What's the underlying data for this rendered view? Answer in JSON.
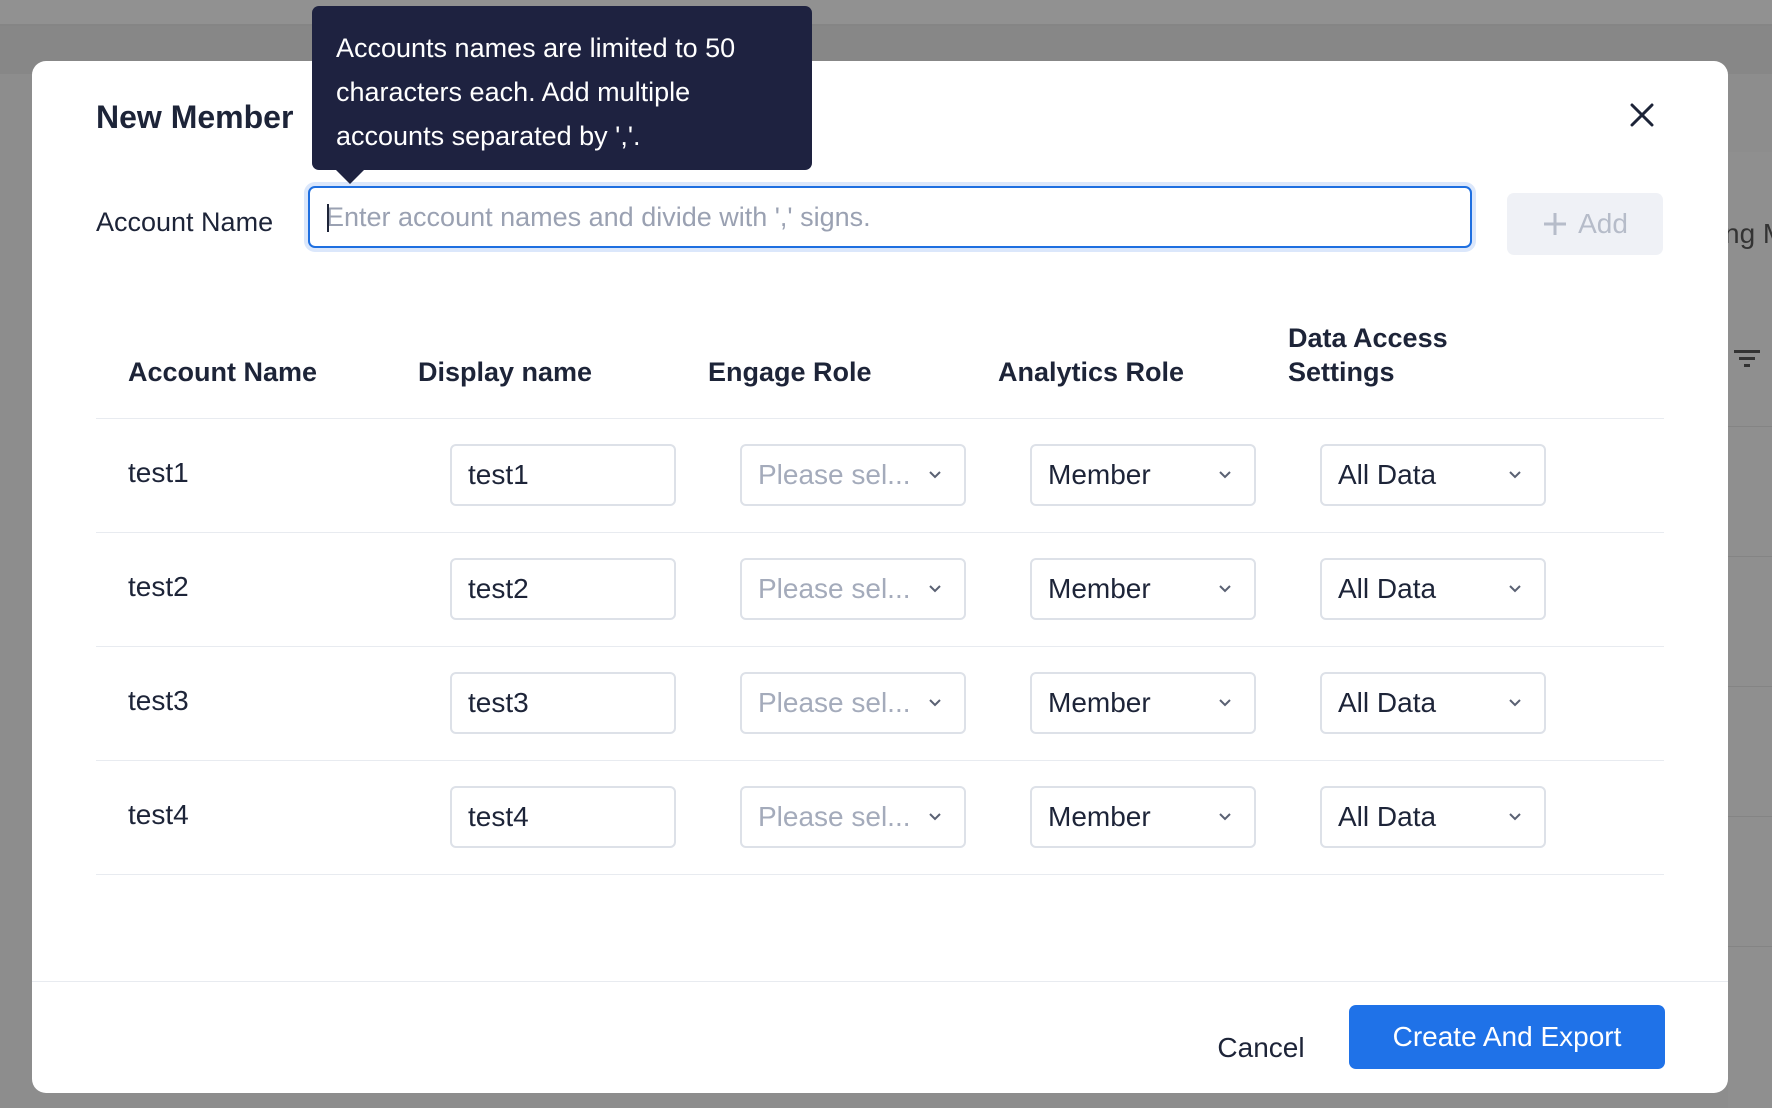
{
  "dialog": {
    "title": "New Member",
    "close_icon": "close-icon"
  },
  "add_row": {
    "label": "Account Name",
    "input_placeholder": "Enter account names and divide with ',' signs.",
    "input_value": "",
    "add_button_label": "Add",
    "add_icon": "plus-icon"
  },
  "tooltip": {
    "text": "Accounts names are limited to 50 characters each. Add multiple accounts separated by ','."
  },
  "table": {
    "headers": [
      "Account Name",
      "Display name",
      "Engage Role",
      "Analytics Role",
      "Data Access Settings"
    ],
    "rows": [
      {
        "account_name": "test1",
        "display_name": "test1",
        "engage_role": "Please sel...",
        "analytics_role": "Member",
        "data_access": "All Data"
      },
      {
        "account_name": "test2",
        "display_name": "test2",
        "engage_role": "Please sel...",
        "analytics_role": "Member",
        "data_access": "All Data"
      },
      {
        "account_name": "test3",
        "display_name": "test3",
        "engage_role": "Please sel...",
        "analytics_role": "Member",
        "data_access": "All Data"
      },
      {
        "account_name": "test4",
        "display_name": "test4",
        "engage_role": "Please sel...",
        "analytics_role": "Member",
        "data_access": "All Data"
      }
    ]
  },
  "footer": {
    "cancel_label": "Cancel",
    "primary_label": "Create And Export"
  },
  "background": {
    "partial_text": "ng M",
    "filter_icon": "filter-icon"
  },
  "colors": {
    "primary": "#1f72e8",
    "tooltip_bg": "#1e2240",
    "text": "#1d2438",
    "placeholder": "#a4abbb"
  }
}
